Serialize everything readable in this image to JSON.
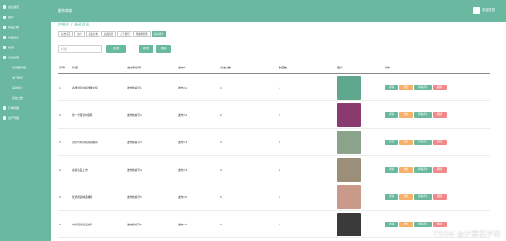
{
  "sidebar": {
    "items": [
      {
        "label": "后台首页",
        "icon": "home-icon",
        "sub": false
      },
      {
        "label": "用户",
        "icon": "user-icon",
        "sub": false
      },
      {
        "label": "商品分类",
        "icon": "category-icon",
        "sub": false
      },
      {
        "label": "商品信息",
        "icon": "goods-icon",
        "sub": false
      },
      {
        "label": "新闻",
        "icon": "news-icon",
        "sub": false
      },
      {
        "label": "系统管理",
        "icon": "gear-icon",
        "sub": false
      },
      {
        "label": "轮播图管理",
        "icon": "",
        "sub": true
      },
      {
        "label": "关于我们",
        "icon": "",
        "sub": true
      },
      {
        "label": "系统简介",
        "icon": "",
        "sub": true
      },
      {
        "label": "系统公告",
        "icon": "",
        "sub": true
      },
      {
        "label": "订单管理",
        "icon": "order-icon",
        "sub": false
      },
      {
        "label": "资产管理",
        "icon": "asset-icon",
        "sub": false
      }
    ]
  },
  "header": {
    "title": "服饰商城",
    "user_name": "欢迎登录"
  },
  "breadcrumb": [
    "控制台",
    "新闻资讯"
  ],
  "tags": [
    {
      "label": "后台首页",
      "active": false
    },
    {
      "label": "用户",
      "active": false
    },
    {
      "label": "商品分类",
      "active": false
    },
    {
      "label": "商品信息",
      "active": false
    },
    {
      "label": "关于我们",
      "active": false
    },
    {
      "label": "轮播图管理",
      "active": false
    },
    {
      "label": "新闻资讯",
      "active": true
    }
  ],
  "search": {
    "placeholder": "标题",
    "button": "查询"
  },
  "actions": {
    "add": "新增",
    "delete": "删除"
  },
  "table": {
    "headers": [
      "序号",
      "标题",
      "发布者编号",
      "发布人",
      "点击次数",
      "收藏数",
      "图片",
      "操作"
    ],
    "rows": [
      {
        "no": "1",
        "title": "春季穿搭时尚优雅女装",
        "num": "发布者编号1",
        "pub": "发布人1",
        "cnt": "1",
        "view": "1",
        "img_color": "#5fa88e"
      },
      {
        "no": "2",
        "title": "新一季潮流时装风",
        "num": "发布者编号2",
        "pub": "发布人2",
        "cnt": "2",
        "view": "2",
        "img_color": "#8a3a6e"
      },
      {
        "no": "3",
        "title": "流行时尚穿搭指南推荐",
        "num": "发布者编号3",
        "pub": "发布人3",
        "cnt": "3",
        "view": "3",
        "img_color": "#8aa38a"
      },
      {
        "no": "4",
        "title": "春夏新品上市",
        "num": "发布者编号4",
        "pub": "发布人4",
        "cnt": "4",
        "view": "4",
        "img_color": "#9c8f7a"
      },
      {
        "no": "5",
        "title": "优质服装精选推荐",
        "num": "发布者编号5",
        "pub": "发布人5",
        "cnt": "5",
        "view": "5",
        "img_color": "#c99a8a"
      },
      {
        "no": "6",
        "title": "时尚潮流新品分享",
        "num": "发布者编号6",
        "pub": "发布人6",
        "cnt": "6",
        "view": "6",
        "img_color": "#3a3a3a"
      }
    ],
    "op_labels": {
      "view": "详情",
      "edit": "修改",
      "comment": "查看评论",
      "del": "删除"
    }
  },
  "watermark": "CSDN @计算机毕设",
  "colors": {
    "primary": "#6ab8a0",
    "edit": "#f5b06b",
    "delete": "#f08a8a"
  }
}
